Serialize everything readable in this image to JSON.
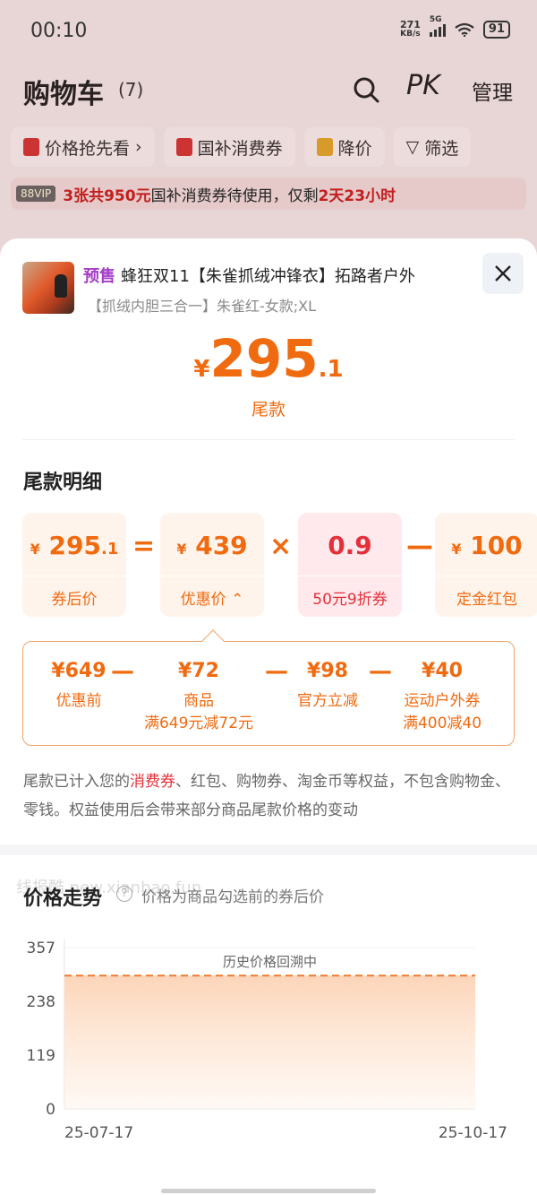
{
  "status_bar": {
    "time": "00:10",
    "net_speed_value": "271",
    "net_speed_unit": "KB/s",
    "network": "5G",
    "battery": "91"
  },
  "header": {
    "title": "购物车",
    "count": "(7)",
    "pk": "PK",
    "manage": "管理"
  },
  "chips": [
    "价格抢先看",
    "国补消费券",
    "降价",
    "筛选"
  ],
  "promo": {
    "badge": "88VIP",
    "text_a": "3张共950元",
    "text_b": "国补消费券待使用，仅剩",
    "text_c": "2天23小时"
  },
  "product": {
    "presale": "预售",
    "title": "蜂狂双11【朱雀抓绒冲锋衣】拓路者户外",
    "spec": "【抓绒内胆三合一】朱雀红-女款;XL"
  },
  "final_price": {
    "yen": "¥",
    "int": "295",
    "dec": ".1",
    "label": "尾款"
  },
  "breakdown": {
    "title": "尾款明细",
    "boxes": [
      {
        "yen": "¥",
        "int": "295",
        "dec": ".1",
        "label": "券后价"
      },
      {
        "yen": "¥",
        "int": "439",
        "dec": "",
        "label": "优惠价"
      },
      {
        "yen": "",
        "int": "0.9",
        "dec": "",
        "label": "50元9折券"
      },
      {
        "yen": "¥",
        "int": "100",
        "dec": "",
        "label": "定金红包"
      }
    ],
    "ops": [
      "=",
      "×",
      "—"
    ],
    "detail": [
      {
        "value": "¥649",
        "label": "优惠前",
        "sub": ""
      },
      {
        "value": "¥72",
        "label": "商品",
        "sub": "满649元减72元"
      },
      {
        "value": "¥98",
        "label": "官方立减",
        "sub": ""
      },
      {
        "value": "¥40",
        "label": "运动户外券",
        "sub": "满400减40"
      }
    ],
    "detail_ops": [
      "—",
      "—",
      "—"
    ]
  },
  "note": {
    "a": "尾款已计入您的",
    "hl": "消费券",
    "b": "、红包、购物券、淘金币等权益，不包含购物金、零钱。权益使用后会带来部分商品尾款价格的变动"
  },
  "trend": {
    "title": "价格走势",
    "subtitle": "价格为商品勾选前的券后价",
    "watermark": "线报酷 new.xianbao.fun"
  },
  "chart_data": {
    "type": "area",
    "annotation": "历史价格回溯中",
    "yticks": [
      "357",
      "238",
      "119",
      "0"
    ],
    "ylim": [
      0,
      357
    ],
    "x": [
      "25-07-17",
      "25-10-17"
    ],
    "values": [
      295.1,
      295.1
    ],
    "xlabels": [
      "25-07-17",
      "25-10-17"
    ],
    "line_color": "#f07a30",
    "line_style": "dashed"
  }
}
